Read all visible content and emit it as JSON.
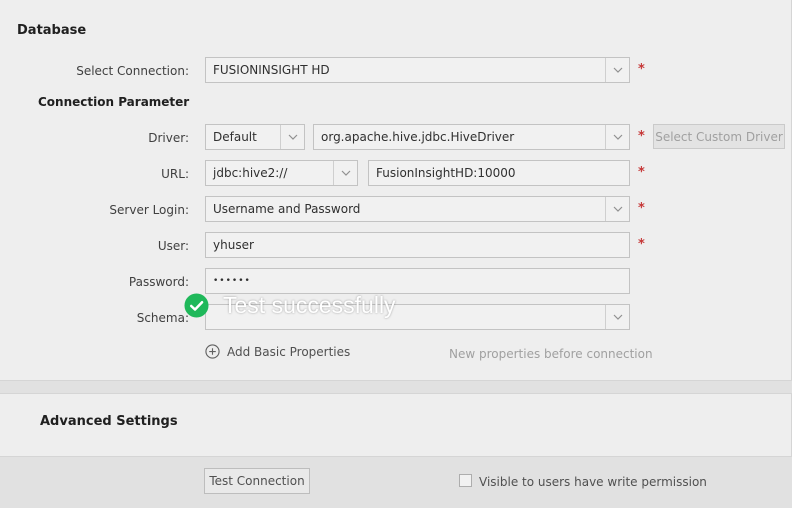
{
  "database": {
    "title": "Database",
    "select_connection": {
      "label": "Select Connection:",
      "value": "FUSIONINSIGHT HD"
    },
    "connection_parameter": {
      "title": "Connection Parameter",
      "driver": {
        "label": "Driver:",
        "type_value": "Default",
        "class_value": "org.apache.hive.jdbc.HiveDriver",
        "custom_button": "Select Custom Driver"
      },
      "url": {
        "label": "URL:",
        "prefix_value": "jdbc:hive2://",
        "host_value": "FusionInsightHD:10000"
      },
      "server_login": {
        "label": "Server Login:",
        "value": "Username and Password"
      },
      "user": {
        "label": "User:",
        "value": "yhuser"
      },
      "password": {
        "label": "Password:",
        "value": "••••••"
      },
      "schema": {
        "label": "Schema:",
        "value": ""
      },
      "add_basic_properties": "Add Basic Properties",
      "hint": "New properties before connection"
    },
    "required_mark": "*"
  },
  "advanced": {
    "title": "Advanced Settings"
  },
  "footer": {
    "test_button": "Test Connection",
    "visible_checkbox_label": "Visible to users have write permission",
    "visible_checked": false
  },
  "toast": {
    "message": "Test successfully",
    "icon": "check-circle-icon",
    "color": "#1fb85a"
  }
}
